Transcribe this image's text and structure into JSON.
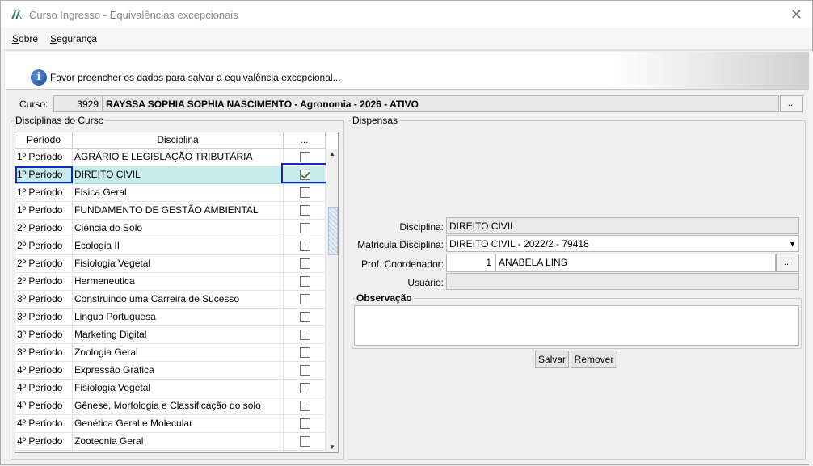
{
  "window": {
    "title": "Curso Ingresso - Equivalências excepcionais",
    "close_glyph": "✕"
  },
  "menu": {
    "items": [
      {
        "label": "Sobre",
        "underline": "S"
      },
      {
        "label": "Segurança",
        "underline": "S"
      }
    ]
  },
  "banner": {
    "icon": "info-icon",
    "icon_glyph": "i",
    "text": "Favor preencher os dados para salvar a equivalência excepcional..."
  },
  "curso": {
    "label": "Curso:",
    "id": "3929",
    "name": "RAYSSA SOPHIA SOPHIA NASCIMENTO - Agronomia - 2026 - ATIVO",
    "lookup_label": "..."
  },
  "disciplinas": {
    "group_title": "Disciplinas do Curso",
    "columns": [
      "Período",
      "Disciplina",
      "..."
    ],
    "rows": [
      {
        "periodo": "1º Período",
        "disciplina": "AGRÁRIO E LEGISLAÇÃO TRIBUTÁRIA",
        "checked": false
      },
      {
        "periodo": "1º Período",
        "disciplina": "DIREITO CIVIL",
        "checked": true,
        "selected": true
      },
      {
        "periodo": "1º Período",
        "disciplina": "Física Geral",
        "checked": false
      },
      {
        "periodo": "1º Período",
        "disciplina": "FUNDAMENTO DE GESTÃO AMBIENTAL",
        "checked": false
      },
      {
        "periodo": "2º Período",
        "disciplina": "Ciência do Solo",
        "checked": false
      },
      {
        "periodo": "2º Período",
        "disciplina": "Ecologia II",
        "checked": false
      },
      {
        "periodo": "2º Período",
        "disciplina": "Fisiologia Vegetal",
        "checked": false
      },
      {
        "periodo": "2º Período",
        "disciplina": "Hermeneutica",
        "checked": false
      },
      {
        "periodo": "3º Período",
        "disciplina": "Construindo uma Carreira de Sucesso",
        "checked": false
      },
      {
        "periodo": "3º Período",
        "disciplina": "Lingua Portuguesa",
        "checked": false
      },
      {
        "periodo": "3º Período",
        "disciplina": "Marketing Digital",
        "checked": false
      },
      {
        "periodo": "3º Período",
        "disciplina": "Zoologia Geral",
        "checked": false
      },
      {
        "periodo": "4º Período",
        "disciplina": "Expressão Gráfica",
        "checked": false
      },
      {
        "periodo": "4º Período",
        "disciplina": "Fisiologia Vegetal",
        "checked": false
      },
      {
        "periodo": "4º Período",
        "disciplina": "Gênese, Morfologia e Classificação do solo",
        "checked": false
      },
      {
        "periodo": "4º Período",
        "disciplina": "Genética Geral e Molecular",
        "checked": false
      },
      {
        "periodo": "4º Período",
        "disciplina": "Zootecnia Geral",
        "checked": false
      }
    ]
  },
  "dispensas": {
    "group_title": "Dispensas",
    "disciplina_label": "Disciplina:",
    "disciplina_value": "DIREITO CIVIL",
    "matricula_label": "Matricula Disciplina:",
    "matricula_value": "DIREITO CIVIL - 2022/2 - 79418",
    "coordenador_label": "Prof. Coordenador:",
    "coordenador_id": "1",
    "coordenador_name": "ANABELA LINS",
    "coordenador_lookup": "...",
    "usuario_label": "Usuário:",
    "usuario_value": "",
    "observacao_title": "Observação",
    "observacao_value": "",
    "salvar_label": "Salvar",
    "remover_label": "Remover"
  }
}
